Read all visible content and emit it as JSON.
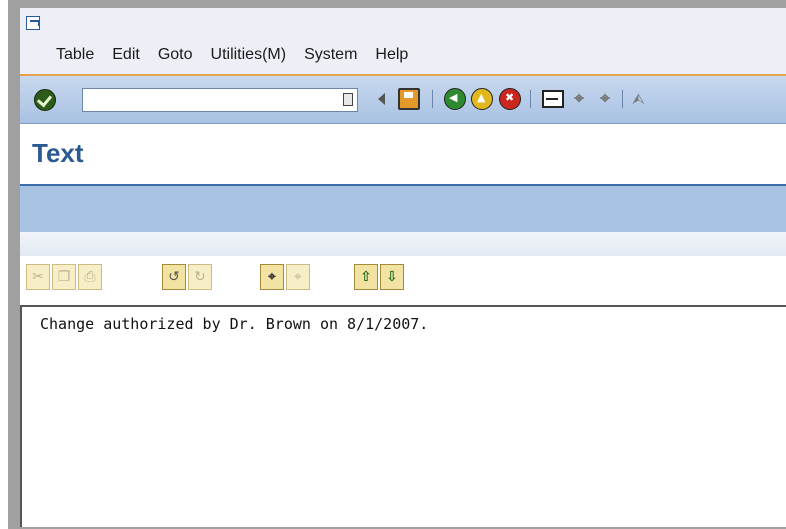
{
  "menu": {
    "items": [
      "Table",
      "Edit",
      "Goto",
      "Utilities(M)",
      "System",
      "Help"
    ]
  },
  "toolbar": {
    "command_field_value": "",
    "icons": [
      "enter-icon",
      "command-history-icon",
      "collapse-arrow-icon",
      "save-icon",
      "back-icon",
      "exit-icon",
      "cancel-icon",
      "print-icon",
      "find-icon",
      "find-next-icon",
      "first-page-icon"
    ]
  },
  "title": {
    "text": "Text"
  },
  "edit_toolbar": {
    "icons": [
      "cut-icon",
      "copy-icon",
      "paste-icon",
      "undo-icon",
      "redo-icon",
      "find-icon",
      "find-next-icon",
      "upload-icon",
      "download-icon"
    ]
  },
  "editor": {
    "content": "Change authorized by Dr. Brown on 8/1/2007."
  },
  "colors": {
    "menu_bg": "#ecf0f6",
    "menu_accent": "#e6a24a",
    "toolbar_bg": "#a9c2e3",
    "title_color": "#2b5a91",
    "app_toolbar_bg": "#a9c3e5"
  }
}
